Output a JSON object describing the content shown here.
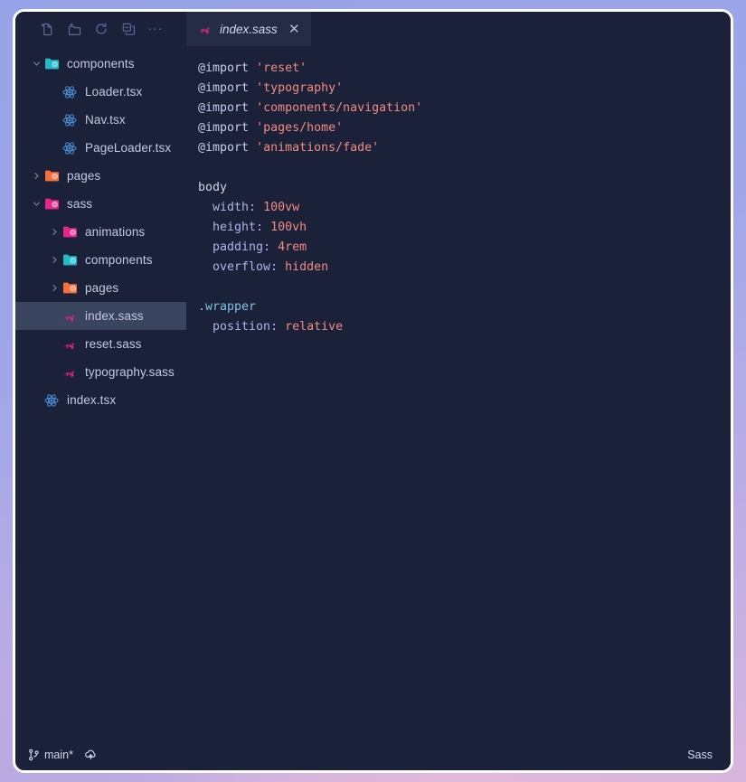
{
  "window": {
    "accent_pink": "#e6268a",
    "background_dark": "#1b2138",
    "tab_active_bg": "#252c46",
    "selection_bg": "#39445f"
  },
  "toolbar": {
    "buttons": [
      {
        "name": "new-file-icon",
        "label": "New File"
      },
      {
        "name": "new-folder-icon",
        "label": "New Folder"
      },
      {
        "name": "refresh-icon",
        "label": "Refresh Explorer"
      },
      {
        "name": "collapse-all-icon",
        "label": "Collapse Folders in Explorer"
      }
    ],
    "more_label": "..."
  },
  "tabs": [
    {
      "label": "index.sass",
      "icon": "sass-icon",
      "close_label": "✕",
      "active": true
    }
  ],
  "sidebar": {
    "items": [
      {
        "label": "components",
        "icon": "folder-components-icon",
        "indent": 0,
        "chevron": "down",
        "selected": false
      },
      {
        "label": "Loader.tsx",
        "icon": "react-icon",
        "indent": 1,
        "chevron": "none",
        "selected": false
      },
      {
        "label": "Nav.tsx",
        "icon": "react-icon",
        "indent": 1,
        "chevron": "none",
        "selected": false
      },
      {
        "label": "PageLoader.tsx",
        "icon": "react-icon",
        "indent": 1,
        "chevron": "none",
        "selected": false
      },
      {
        "label": "pages",
        "icon": "folder-pages-icon",
        "indent": 0,
        "chevron": "right",
        "selected": false
      },
      {
        "label": "sass",
        "icon": "folder-sass-icon",
        "indent": 0,
        "chevron": "down",
        "selected": false
      },
      {
        "label": "animations",
        "icon": "folder-animations-icon",
        "indent": 1,
        "chevron": "right",
        "selected": false
      },
      {
        "label": "components",
        "icon": "folder-components-icon",
        "indent": 1,
        "chevron": "right",
        "selected": false
      },
      {
        "label": "pages",
        "icon": "folder-pages-icon",
        "indent": 1,
        "chevron": "right",
        "selected": false
      },
      {
        "label": "index.sass",
        "icon": "sass-icon",
        "indent": 1,
        "chevron": "none",
        "selected": true
      },
      {
        "label": "reset.sass",
        "icon": "sass-icon",
        "indent": 1,
        "chevron": "none",
        "selected": false
      },
      {
        "label": "typography.sass",
        "icon": "sass-icon",
        "indent": 1,
        "chevron": "none",
        "selected": false
      },
      {
        "label": "index.tsx",
        "icon": "react-icon",
        "indent": 0,
        "chevron": "none",
        "selected": false
      }
    ]
  },
  "editor": {
    "language": "Sass",
    "lines": [
      [
        {
          "t": "@import",
          "c": "kw"
        },
        {
          "t": " ",
          "c": "punc"
        },
        {
          "t": "'reset'",
          "c": "str"
        }
      ],
      [
        {
          "t": "@import",
          "c": "kw"
        },
        {
          "t": " ",
          "c": "punc"
        },
        {
          "t": "'typography'",
          "c": "str"
        }
      ],
      [
        {
          "t": "@import",
          "c": "kw"
        },
        {
          "t": " ",
          "c": "punc"
        },
        {
          "t": "'components/navigation'",
          "c": "str"
        }
      ],
      [
        {
          "t": "@import",
          "c": "kw"
        },
        {
          "t": " ",
          "c": "punc"
        },
        {
          "t": "'pages/home'",
          "c": "str"
        }
      ],
      [
        {
          "t": "@import",
          "c": "kw"
        },
        {
          "t": " ",
          "c": "punc"
        },
        {
          "t": "'animations/fade'",
          "c": "str"
        }
      ],
      [],
      [
        {
          "t": "body",
          "c": "sel"
        }
      ],
      [
        {
          "t": "  width",
          "c": "prop"
        },
        {
          "t": ": ",
          "c": "punc"
        },
        {
          "t": "100vw",
          "c": "val"
        }
      ],
      [
        {
          "t": "  height",
          "c": "prop"
        },
        {
          "t": ": ",
          "c": "punc"
        },
        {
          "t": "100vh",
          "c": "val"
        }
      ],
      [
        {
          "t": "  padding",
          "c": "prop"
        },
        {
          "t": ": ",
          "c": "punc"
        },
        {
          "t": "4rem",
          "c": "val"
        }
      ],
      [
        {
          "t": "  overflow",
          "c": "prop"
        },
        {
          "t": ": ",
          "c": "punc"
        },
        {
          "t": "hidden",
          "c": "val"
        }
      ],
      [],
      [
        {
          "t": ".wrapper",
          "c": "cls"
        }
      ],
      [
        {
          "t": "  position",
          "c": "prop"
        },
        {
          "t": ": ",
          "c": "punc"
        },
        {
          "t": "relative",
          "c": "val"
        }
      ]
    ]
  },
  "statusbar": {
    "branch": "main*",
    "branch_icon": "git-branch-icon",
    "sync_icon": "cloud-sync-icon",
    "language": "Sass"
  }
}
